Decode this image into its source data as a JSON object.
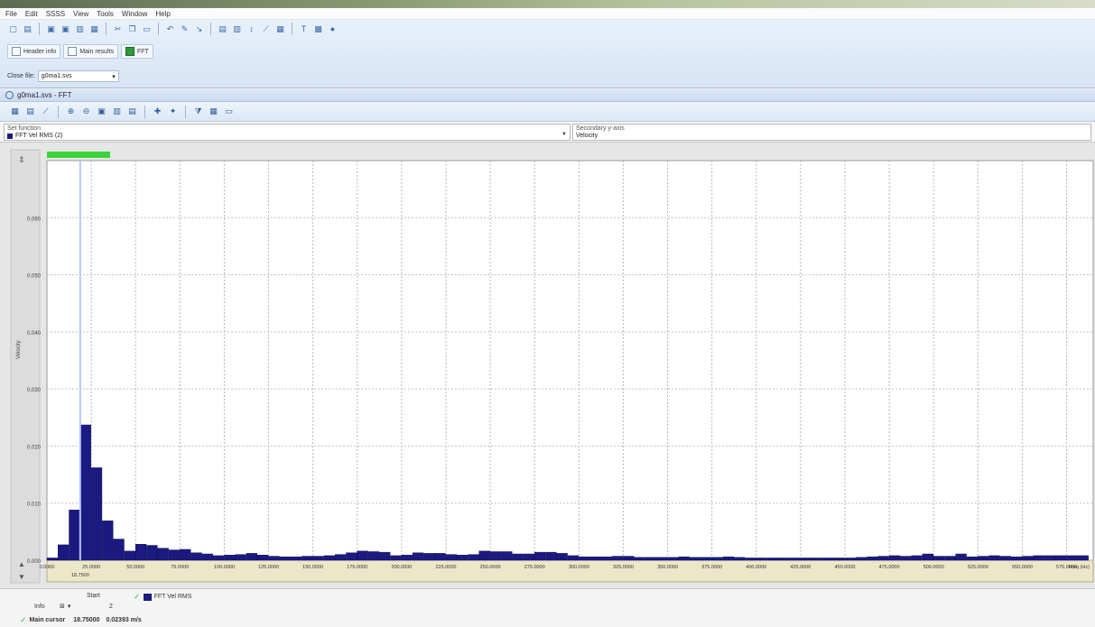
{
  "menu": [
    "File",
    "Edit",
    "SSSS",
    "View",
    "Tools",
    "Window",
    "Help"
  ],
  "toolbar_buttons": [
    "Header info",
    "Main results",
    "FFT"
  ],
  "file_label": "Close file:",
  "file_value": "g0ma1.svs",
  "panel_title": "g0ma1.svs - FFT",
  "set_function_label": "Set function",
  "set_function_value": "FFT Vel RMS (2)",
  "secondary_axis_label": "Secondary y-axis",
  "secondary_axis_value": "Velocity",
  "status": {
    "start_label": "Start",
    "series_label": "FFT Vel RMS",
    "info_label": "Info",
    "info_value": "2",
    "cursor_label": "Main cursor",
    "cursor_value": "18.75000",
    "cursor_reading": "0.02393 m/s"
  },
  "colors": {
    "bar": "#1a1a80",
    "cursor": "#b8c4ff",
    "progress": "#3ad43a"
  },
  "chart_data": {
    "type": "bar",
    "ylabel": "Velocity",
    "xlabel": "Freq (Hz)",
    "xlim": [
      0,
      590
    ],
    "ylim": [
      0,
      0.07
    ],
    "bin_width": 6.25,
    "x_ticks": [
      "0.0000",
      "25.0000",
      "50.0000",
      "75.0000",
      "100.0000",
      "125.0000",
      "150.0000",
      "175.0000",
      "200.0000",
      "225.0000",
      "250.0000",
      "275.0000",
      "300.0000",
      "325.0000",
      "350.0000",
      "375.0000",
      "400.0000",
      "425.0000",
      "450.0000",
      "475.0000",
      "500.0000",
      "525.0000",
      "550.0000",
      "575.0000"
    ],
    "x_tick_values": [
      0,
      25,
      50,
      75,
      100,
      125,
      150,
      175,
      200,
      225,
      250,
      275,
      300,
      325,
      350,
      375,
      400,
      425,
      450,
      475,
      500,
      525,
      550,
      575
    ],
    "y_ticks": [
      "0.000",
      "0.010",
      "0.020",
      "0.030",
      "0.040",
      "0.050",
      "0.060"
    ],
    "y_tick_values": [
      0,
      0.01,
      0.02,
      0.03,
      0.04,
      0.05,
      0.06
    ],
    "cursor_x": 18.75,
    "values": [
      0.0004,
      0.0027,
      0.0088,
      0.0237,
      0.0162,
      0.0069,
      0.0037,
      0.0016,
      0.0028,
      0.0026,
      0.0021,
      0.0018,
      0.0019,
      0.0013,
      0.0011,
      0.0008,
      0.0009,
      0.001,
      0.0012,
      0.0009,
      0.0007,
      0.0006,
      0.0006,
      0.0007,
      0.0007,
      0.0008,
      0.001,
      0.0013,
      0.0016,
      0.0015,
      0.0014,
      0.0008,
      0.0009,
      0.0013,
      0.0012,
      0.0012,
      0.001,
      0.0009,
      0.001,
      0.0016,
      0.0015,
      0.0015,
      0.0011,
      0.0011,
      0.0014,
      0.0014,
      0.0012,
      0.0008,
      0.0006,
      0.0006,
      0.0006,
      0.0007,
      0.0007,
      0.0005,
      0.0005,
      0.0005,
      0.0005,
      0.0006,
      0.0005,
      0.0005,
      0.0005,
      0.0006,
      0.0005,
      0.0004,
      0.0004,
      0.0004,
      0.0004,
      0.0004,
      0.0004,
      0.0004,
      0.0004,
      0.0004,
      0.0004,
      0.0005,
      0.0006,
      0.0007,
      0.0008,
      0.0007,
      0.0008,
      0.0011,
      0.0007,
      0.0007,
      0.0011,
      0.0006,
      0.0007,
      0.0008,
      0.0007,
      0.0006,
      0.0007,
      0.0008,
      0.0008,
      0.0008,
      0.0008,
      0.0008
    ]
  }
}
